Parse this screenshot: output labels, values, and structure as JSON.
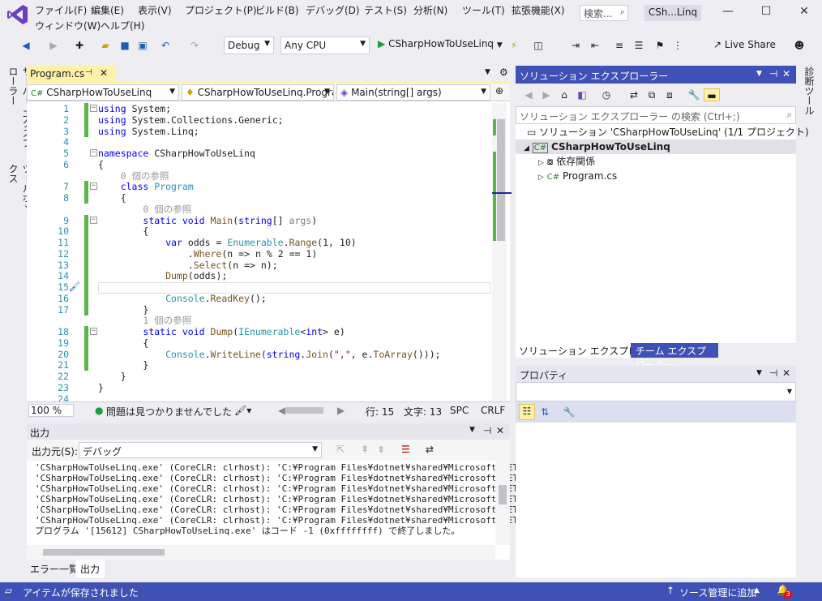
{
  "menu": [
    "ファイル(F)",
    "編集(E)",
    "表示(V)",
    "プロジェクト(P)",
    "ビルド(B)",
    "デバッグ(D)",
    "テスト(S)",
    "分析(N)",
    "ツール(T)",
    "拡張機能(X)",
    "ウィンドウ(W)",
    "ヘルプ(H)"
  ],
  "search_placeholder": "検索...",
  "project_badge": "CSh...Linq",
  "toolbar": {
    "config": "Debug",
    "platform": "Any CPU",
    "start_label": "CSharpHowToUseLinq",
    "live_share": "Live Share"
  },
  "left_tabs": [
    "サーバー エクスプローラー",
    "ツールボックス"
  ],
  "right_tab": "診断ツール",
  "editor": {
    "tab_title": "Program.cs",
    "nav": [
      "CSharpHowToUseLinq",
      "CSharpHowToUseLinq.Progra",
      "Main(string[] args)"
    ],
    "lines": [
      {
        "n": "1",
        "t": "using System;"
      },
      {
        "n": "2",
        "t": "using System.Collections.Generic;"
      },
      {
        "n": "3",
        "t": "using System.Linq;"
      },
      {
        "n": "4",
        "t": ""
      },
      {
        "n": "5",
        "t": "namespace CSharpHowToUseLinq"
      },
      {
        "n": "6",
        "t": "{"
      },
      {
        "n": "",
        "t": "    0 個の参照"
      },
      {
        "n": "7",
        "t": "    class Program"
      },
      {
        "n": "8",
        "t": "    {"
      },
      {
        "n": "",
        "t": "        0 個の参照"
      },
      {
        "n": "9",
        "t": "        static void Main(string[] args)"
      },
      {
        "n": "10",
        "t": "        {"
      },
      {
        "n": "11",
        "t": "            var odds = Enumerable.Range(1, 10)"
      },
      {
        "n": "12",
        "t": "                .Where(n => n % 2 == 1)"
      },
      {
        "n": "13",
        "t": "                .Select(n => n);"
      },
      {
        "n": "14",
        "t": "            Dump(odds);"
      },
      {
        "n": "15",
        "t": ""
      },
      {
        "n": "16",
        "t": "            Console.ReadKey();"
      },
      {
        "n": "17",
        "t": "        }"
      },
      {
        "n": "",
        "t": "        1 個の参照"
      },
      {
        "n": "18",
        "t": "        static void Dump(IEnumerable<int> e)"
      },
      {
        "n": "19",
        "t": "        {"
      },
      {
        "n": "20",
        "t": "            Console.WriteLine(string.Join(\",\", e.ToArray()));"
      },
      {
        "n": "21",
        "t": "        }"
      },
      {
        "n": "22",
        "t": "    }"
      },
      {
        "n": "23",
        "t": "}"
      },
      {
        "n": "24",
        "t": ""
      }
    ],
    "zoom": "100 %",
    "issues": "問題は見つかりませんでした",
    "row": "行: 15",
    "col": "文字: 13",
    "spc": "SPC",
    "eol": "CRLF"
  },
  "output": {
    "title": "出力",
    "source_label": "出力元(S):",
    "source_value": "デバッグ",
    "lines": [
      "'CSharpHowToUseLinq.exe' (CoreCLR: clrhost): 'C:¥Program Files¥dotnet¥shared¥Microsoft.NETCore",
      "'CSharpHowToUseLinq.exe' (CoreCLR: clrhost): 'C:¥Program Files¥dotnet¥shared¥Microsoft.NETCore",
      "'CSharpHowToUseLinq.exe' (CoreCLR: clrhost): 'C:¥Program Files¥dotnet¥shared¥Microsoft.NETCore",
      "'CSharpHowToUseLinq.exe' (CoreCLR: clrhost): 'C:¥Program Files¥dotnet¥shared¥Microsoft.NETCore",
      "'CSharpHowToUseLinq.exe' (CoreCLR: clrhost): 'C:¥Program Files¥dotnet¥shared¥Microsoft.NETCore",
      "'CSharpHowToUseLinq.exe' (CoreCLR: clrhost): 'C:¥Program Files¥dotnet¥shared¥Microsoft.NETCore",
      "プログラム '[15612] CSharpHowToUseLinq.exe' はコード -1 (0xffffffff) で終了しました。"
    ],
    "tabs": [
      "エラー一覧",
      "出力"
    ]
  },
  "solution_explorer": {
    "title": "ソリューション エクスプローラー",
    "search_placeholder": "ソリューション エクスプローラー の検索 (Ctrl+;)",
    "solution": "ソリューション 'CSharpHowToUseLinq' (1/1 プロジェクト)",
    "project": "CSharpHowToUseLinq",
    "dependencies": "依存関係",
    "file": "Program.cs",
    "tabs": [
      "ソリューション エクスプローラー",
      "チーム エクスプローラー"
    ]
  },
  "properties": {
    "title": "プロパティ"
  },
  "status": {
    "message": "アイテムが保存されました",
    "scm": "ソース管理に追加",
    "notif_count": "3"
  },
  "colors": {
    "accent": "#3f51b5",
    "active_tab": "#fff1a8",
    "change_bar": "#57b847"
  }
}
